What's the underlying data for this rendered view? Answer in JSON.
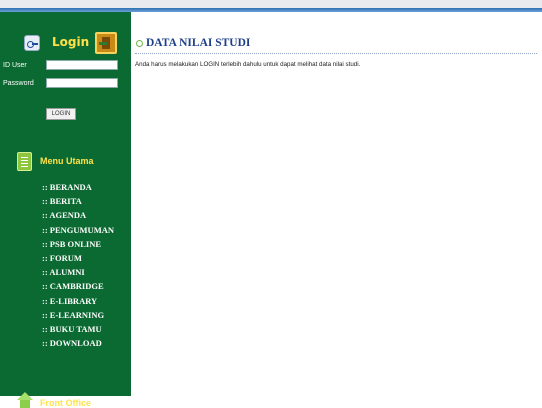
{
  "sidebar": {
    "login": {
      "title": "Login",
      "user_label": "ID User",
      "user_value": "",
      "password_label": "Password",
      "password_value": "",
      "button_label": "LOGIN"
    },
    "menu_title": "Menu Utama",
    "menu_items": [
      ":: BERANDA",
      ":: BERITA",
      ":: AGENDA",
      ":: PENGUMUMAN",
      ":: PSB ONLINE",
      ":: FORUM",
      ":: ALUMNI",
      ":: CAMBRIDGE",
      ":: E-LIBRARY",
      ":: E-LEARNING",
      ":: BUKU TAMU",
      ":: DOWNLOAD"
    ],
    "front_office_title": "Front Office"
  },
  "main": {
    "title": "DATA NILAI STUDI",
    "notice": "Anda harus melakukan LOGIN terlebih dahulu untuk dapat melihat data nilai studi."
  },
  "colors": {
    "sidebar_bg": "#0b6a31",
    "heading_yellow": "#ffe24a",
    "title_blue": "#1e3f88"
  },
  "icons": {
    "login_left": "key-icon",
    "login_right": "door-icon",
    "menu": "document-icon",
    "front_office": "house-icon",
    "title_bullet": "circle-bullet-icon"
  }
}
